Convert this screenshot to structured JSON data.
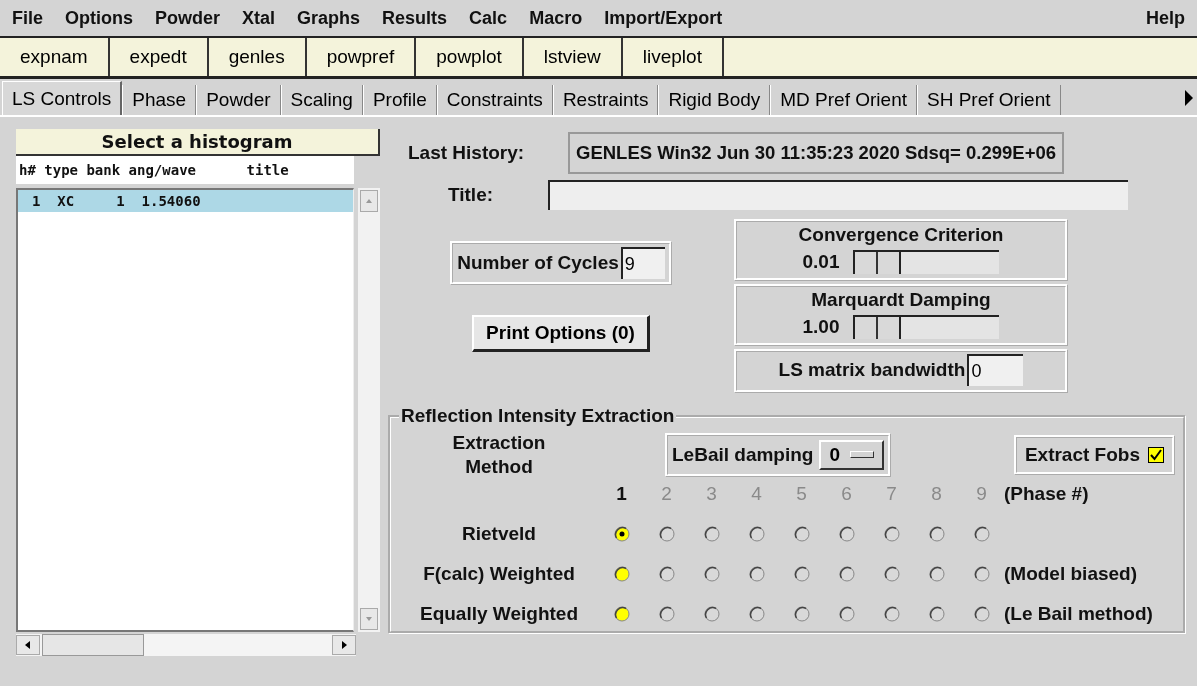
{
  "menu": [
    "File",
    "Options",
    "Powder",
    "Xtal",
    "Graphs",
    "Results",
    "Calc",
    "Macro",
    "Import/Export"
  ],
  "help_menu": "Help",
  "toolbar": [
    "expnam",
    "expedt",
    "genles",
    "powpref",
    "powplot",
    "lstview",
    "liveplot"
  ],
  "tabs": [
    {
      "label": "LS Controls",
      "selected": true
    },
    {
      "label": "Phase",
      "selected": false
    },
    {
      "label": "Powder",
      "selected": false
    },
    {
      "label": "Scaling",
      "selected": false
    },
    {
      "label": "Profile",
      "selected": false
    },
    {
      "label": "Constraints",
      "selected": false
    },
    {
      "label": "Restraints",
      "selected": false
    },
    {
      "label": "Rigid Body",
      "selected": false
    },
    {
      "label": "MD Pref Orient",
      "selected": false
    },
    {
      "label": "SH Pref Orient",
      "selected": false
    }
  ],
  "histogram": {
    "title": "Select a histogram",
    "header": "h# type bank ang/wave      title",
    "rows": [
      {
        "text": "1  XC     1  1.54060",
        "selected": true
      }
    ]
  },
  "last_history": {
    "label": "Last History:",
    "value": "GENLES  Win32  Jun 30 11:35:23 2020 Sdsq= 0.299E+06"
  },
  "title_field": {
    "label": "Title:"
  },
  "cycles": {
    "label": "Number of Cycles",
    "value": "9"
  },
  "print_options": "Print Options (0)",
  "convergence": {
    "title": "Convergence Criterion",
    "reading": "0.01",
    "level": 0
  },
  "damping": {
    "title": "Marquardt Damping",
    "reading": "1.00",
    "level": 0
  },
  "bandwidth": {
    "label": "LS matrix bandwidth",
    "value": "0"
  },
  "extraction": {
    "title": "Reflection Intensity Extraction",
    "method_label": "Extraction Method",
    "lebail": {
      "label": "LeBail damping",
      "value": "0"
    },
    "fobs": {
      "label": "Extract Fobs",
      "checked": true
    },
    "phases": [
      {
        "label": "1",
        "disabled": false
      },
      {
        "label": "2",
        "disabled": true
      },
      {
        "label": "3",
        "disabled": true
      },
      {
        "label": "4",
        "disabled": true
      },
      {
        "label": "5",
        "disabled": true
      },
      {
        "label": "6",
        "disabled": true
      },
      {
        "label": "7",
        "disabled": true
      },
      {
        "label": "8",
        "disabled": true
      },
      {
        "label": "9",
        "disabled": true
      }
    ],
    "phase_note": "(Phase #)",
    "rows": [
      {
        "label": "Rietveld",
        "options": [
          {
            "selected": true,
            "highlighted": true
          },
          {
            "selected": false,
            "highlighted": false
          },
          {
            "selected": false,
            "highlighted": false
          },
          {
            "selected": false,
            "highlighted": false
          },
          {
            "selected": false,
            "highlighted": false
          },
          {
            "selected": false,
            "highlighted": false
          },
          {
            "selected": false,
            "highlighted": false
          },
          {
            "selected": false,
            "highlighted": false
          },
          {
            "selected": false,
            "highlighted": false
          }
        ]
      },
      {
        "label": "F(calc) Weighted",
        "note": "(Model biased)",
        "options": [
          {
            "selected": false,
            "highlighted": true
          },
          {
            "selected": false,
            "highlighted": false
          },
          {
            "selected": false,
            "highlighted": false
          },
          {
            "selected": false,
            "highlighted": false
          },
          {
            "selected": false,
            "highlighted": false
          },
          {
            "selected": false,
            "highlighted": false
          },
          {
            "selected": false,
            "highlighted": false
          },
          {
            "selected": false,
            "highlighted": false
          },
          {
            "selected": false,
            "highlighted": false
          }
        ]
      },
      {
        "label": "Equally Weighted",
        "note": "(Le Bail method)",
        "options": [
          {
            "selected": false,
            "highlighted": true
          },
          {
            "selected": false,
            "highlighted": false
          },
          {
            "selected": false,
            "highlighted": false
          },
          {
            "selected": false,
            "highlighted": false
          },
          {
            "selected": false,
            "highlighted": false
          },
          {
            "selected": false,
            "highlighted": false
          },
          {
            "selected": false,
            "highlighted": false
          },
          {
            "selected": false,
            "highlighted": false
          },
          {
            "selected": false,
            "highlighted": false
          }
        ]
      }
    ]
  }
}
